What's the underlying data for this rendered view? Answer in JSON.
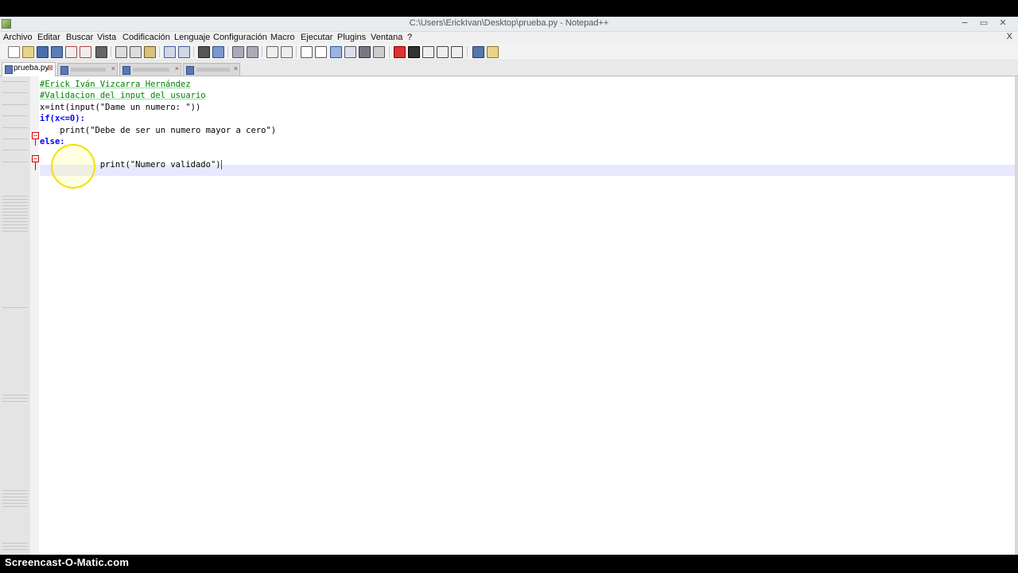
{
  "window": {
    "title": "C:\\Users\\ErickIvan\\Desktop\\prueba.py - Notepad++",
    "controls": {
      "minimize": "−",
      "maximize": "▭",
      "close": "✕"
    }
  },
  "menu": {
    "items": [
      "Archivo",
      "Editar",
      "Buscar",
      "Vista",
      "Codificación",
      "Lenguaje",
      "Configuración",
      "Macro",
      "Ejecutar",
      "Plugins",
      "Ventana",
      "?"
    ],
    "close": "X"
  },
  "tabs": [
    {
      "label": "prueba.py",
      "active": true
    },
    {
      "label": "",
      "active": false
    },
    {
      "label": "",
      "active": false
    },
    {
      "label": "",
      "active": false
    }
  ],
  "code": {
    "lines": [
      "#Erick Iván Vizcarra Hernández",
      "#Validacion del input del usuario",
      "x=int(input(\"Dame un numero: \"))",
      "if(x<=0):",
      "    print(\"Debe de ser un numero mayor a cero\")",
      "else:",
      "    print(\"Numero validado\")"
    ]
  },
  "watermark": "Screencast-O-Matic.com",
  "colors": {
    "comment": "#008000",
    "keyword": "#0000ff",
    "string": "#808080",
    "fold_marker": "#cc0000",
    "cursor_highlight": "#f2e200"
  }
}
